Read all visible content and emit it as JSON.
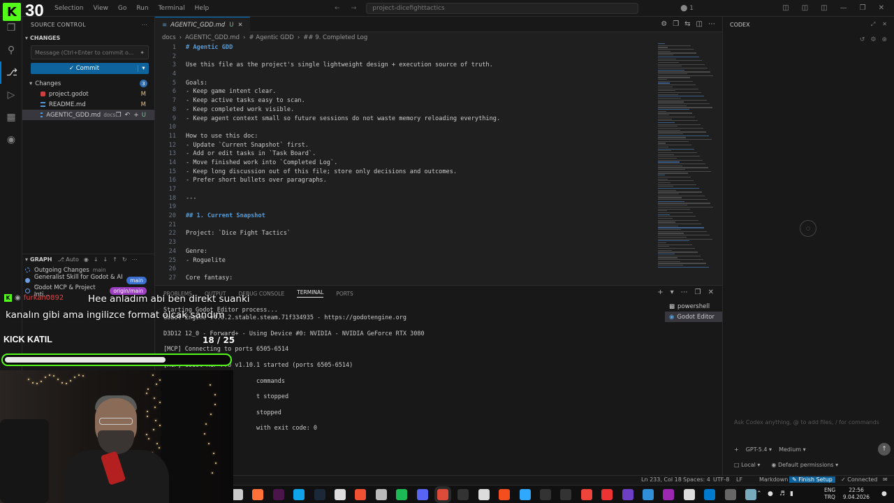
{
  "stream": {
    "kick_logo": "K",
    "viewer_count": "30",
    "chat_user": "furkan0892",
    "chat_line1": "Hee anladım abi ben direkt suanki",
    "chat_line2": "kanalın gibi ama ingilizce format olcak sandım",
    "kick_katil": "KICK KATIL",
    "goal_text": "18 / 25",
    "goal_progress": 0.72
  },
  "titlebar": {
    "menu": [
      "Selection",
      "View",
      "Go",
      "Run",
      "Terminal",
      "Help"
    ],
    "search": "project-dicefighttactics",
    "indicator": "⬤ 1"
  },
  "sidebar": {
    "title": "SOURCE CONTROL",
    "changes_header": "CHANGES",
    "commit_placeholder": "Message (Ctrl+Enter to commit o...",
    "commit_label": "✓ Commit",
    "changes_group": "Changes",
    "changes_count": "3",
    "files": [
      {
        "name": "project.godot",
        "status": "M",
        "dir": ""
      },
      {
        "name": "README.md",
        "status": "M",
        "dir": ""
      },
      {
        "name": "AGENTIC_GDD.md",
        "status": "U",
        "dir": "docs"
      }
    ],
    "graph_header": "GRAPH",
    "graph_auto": "Auto",
    "graph_items": [
      {
        "label": "Outgoing Changes",
        "tag": "main"
      },
      {
        "label": "Generalist Skill for Godot & AI ...",
        "tag": "main"
      },
      {
        "label": "Godot MCP & Project Inti...",
        "tag": "origin/main"
      }
    ]
  },
  "editor": {
    "tab_label": "AGENTIC_GDD.md",
    "tab_status": "U",
    "breadcrumbs": [
      "docs",
      "AGENTIC_GDD.md",
      "# Agentic GDD",
      "## 9. Completed Log"
    ],
    "lines": [
      {
        "n": "1",
        "t": "# Agentic GDD",
        "kind": "h"
      },
      {
        "n": "2",
        "t": "",
        "kind": "p"
      },
      {
        "n": "3",
        "t": "Use this file as the project's single lightweight design + execution source of truth.",
        "kind": "p"
      },
      {
        "n": "4",
        "t": "",
        "kind": "p"
      },
      {
        "n": "5",
        "t": "Goals:",
        "kind": "p"
      },
      {
        "n": "6",
        "t": "- Keep game intent clear.",
        "kind": "p"
      },
      {
        "n": "7",
        "t": "- Keep active tasks easy to scan.",
        "kind": "p"
      },
      {
        "n": "8",
        "t": "- Keep completed work visible.",
        "kind": "p"
      },
      {
        "n": "9",
        "t": "- Keep agent context small so future sessions do not waste memory reloading everything.",
        "kind": "p"
      },
      {
        "n": "10",
        "t": "",
        "kind": "p"
      },
      {
        "n": "11",
        "t": "How to use this doc:",
        "kind": "p"
      },
      {
        "n": "12",
        "t": "- Update `Current Snapshot` first.",
        "kind": "p"
      },
      {
        "n": "13",
        "t": "- Add or edit tasks in `Task Board`.",
        "kind": "p"
      },
      {
        "n": "14",
        "t": "- Move finished work into `Completed Log`.",
        "kind": "p"
      },
      {
        "n": "15",
        "t": "- Keep long discussion out of this file; store only decisions and outcomes.",
        "kind": "p"
      },
      {
        "n": "16",
        "t": "- Prefer short bullets over paragraphs.",
        "kind": "p"
      },
      {
        "n": "17",
        "t": "",
        "kind": "p"
      },
      {
        "n": "18",
        "t": "---",
        "kind": "p"
      },
      {
        "n": "19",
        "t": "",
        "kind": "p"
      },
      {
        "n": "20",
        "t": "## 1. Current Snapshot",
        "kind": "h"
      },
      {
        "n": "21",
        "t": "",
        "kind": "p"
      },
      {
        "n": "22",
        "t": "Project: `Dice Fight Tactics`",
        "kind": "p"
      },
      {
        "n": "23",
        "t": "",
        "kind": "p"
      },
      {
        "n": "24",
        "t": "Genre:",
        "kind": "p"
      },
      {
        "n": "25",
        "t": "- Roguelite",
        "kind": "p"
      },
      {
        "n": "26",
        "t": "",
        "kind": "p"
      },
      {
        "n": "27",
        "t": "Core fantasy:",
        "kind": "p"
      }
    ]
  },
  "panel": {
    "tabs": [
      "PROBLEMS",
      "OUTPUT",
      "DEBUG CONSOLE",
      "TERMINAL",
      "PORTS"
    ],
    "active_tab": "TERMINAL",
    "terminal_lines": [
      "Starting Godot Editor process...",
      "Godot Engine v4.6.2.stable.steam.71f334935 - https://godotengine.org",
      "",
      "D3D12 12_0 - Forward+ - Using Device #0: NVIDIA - NVIDIA GeForce RTX 3080",
      "",
      "[MCP] Connecting to ports 6505-6514",
      "",
      "[MCP] Godot MCP Pro v1.10.1 started (ports 6505-6514)",
      "",
      "                          commands",
      "",
      "                          t stopped",
      "",
      "                          stopped",
      "",
      "                          with exit code: 0"
    ],
    "sessions": [
      "powershell",
      "Godot Editor"
    ]
  },
  "codex": {
    "title": "CODEX",
    "ask_placeholder": "Ask Codex anything, @ to add files, / for commands",
    "model": "GPT-5.4",
    "effort": "Medium",
    "env": "Local",
    "permissions": "Default permissions"
  },
  "statusbar": {
    "position": "Ln 233, Col 18",
    "spaces": "Spaces: 4",
    "encoding": "UTF-8",
    "eol": "LF",
    "language": "Markdown",
    "finish_setup": "Finish Setup",
    "connected": "Connected"
  },
  "taskbar": {
    "lang": "ENG",
    "region": "TRQ",
    "time": "22:56",
    "date": "9.04.2026"
  },
  "colors": {
    "accent": "#0078d4",
    "kick_green": "#53fc18",
    "commit_blue": "#0e639c"
  }
}
